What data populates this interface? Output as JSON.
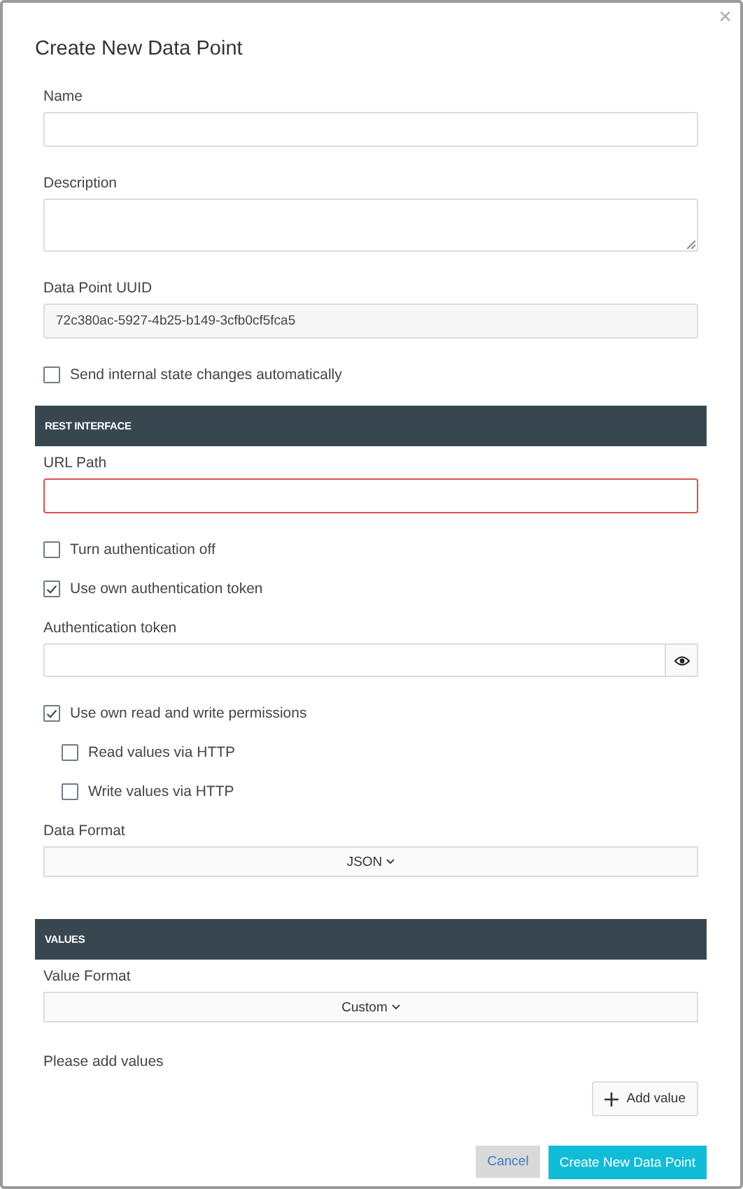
{
  "dialog": {
    "title": "Create New Data Point",
    "close": "×"
  },
  "sections": [
    {
      "items": [
        {
          "kind": "text",
          "label": "Name",
          "invalid": false
        },
        {
          "kind": "textarea",
          "label": "Description"
        },
        {
          "kind": "readonly",
          "label": "Data Point UUID",
          "value": "72c380ac-5927-4b25-b149-3cfb0cf5fca5"
        },
        {
          "kind": "checkbox",
          "label": "Send internal state changes automatically",
          "checked": false
        }
      ]
    },
    {
      "header": "REST INTERFACE",
      "items": [
        {
          "kind": "text",
          "label": "URL Path",
          "invalid": true
        },
        {
          "kind": "checkbox",
          "label": "Turn authentication off",
          "checked": false
        },
        {
          "kind": "checkbox",
          "label": "Use own authentication token",
          "checked": true
        },
        {
          "kind": "password",
          "label": "Authentication token"
        },
        {
          "kind": "checkbox",
          "label": "Use own read and write permissions",
          "checked": true,
          "children": [
            {
              "kind": "checkbox",
              "label": "Read values via HTTP",
              "checked": false
            },
            {
              "kind": "checkbox",
              "label": "Write values via HTTP",
              "checked": false
            }
          ]
        },
        {
          "kind": "select",
          "label": "Data Format",
          "value": "JSON"
        }
      ]
    },
    {
      "header": "VALUES",
      "items": [
        {
          "kind": "select",
          "label": "Value Format",
          "value": "Custom"
        },
        {
          "kind": "note",
          "label": "Please add values"
        },
        {
          "kind": "add",
          "label": "Add value"
        }
      ]
    }
  ],
  "buttons": {
    "cancel": "Cancel",
    "submit": "Create New Data Point"
  }
}
